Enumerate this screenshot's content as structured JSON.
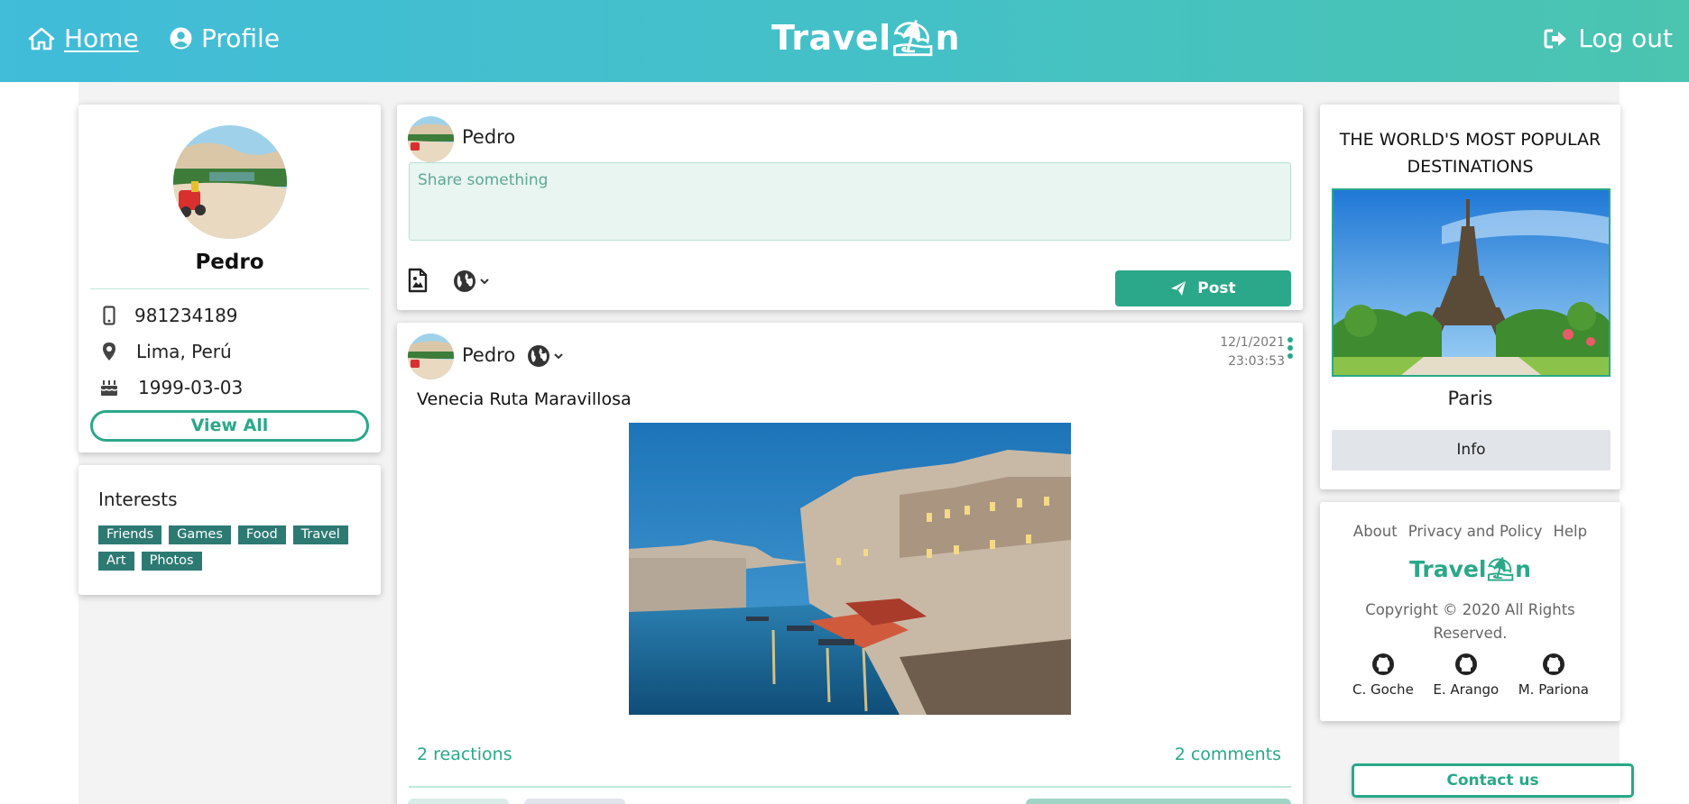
{
  "header": {
    "home_label": "Home",
    "profile_label": "Profile",
    "logo": "Travel⛱n",
    "logout_label": "Log out"
  },
  "profile": {
    "name": "Pedro",
    "phone": "981234189",
    "location": "Lima, Perú",
    "birthday": "1999-03-03",
    "view_all_label": "View All"
  },
  "interests": {
    "title": "Interests",
    "tags": [
      "Friends",
      "Games",
      "Food",
      "Travel",
      "Art",
      "Photos"
    ]
  },
  "composer": {
    "user_name": "Pedro",
    "placeholder": "Share something",
    "post_label": "Post"
  },
  "post": {
    "user_name": "Pedro",
    "date": "12/1/2021",
    "time": "23:03:53",
    "text": "Venecia Ruta Maravillosa",
    "reactions": "2 reactions",
    "comments": "2 comments"
  },
  "destinations": {
    "title": "THE WORLD'S MOST POPULAR DESTINATIONS",
    "city": "Paris",
    "info_label": "Info"
  },
  "footer": {
    "links": [
      "About",
      "Privacy and Policy",
      "Help"
    ],
    "logo": "Travel⛱n",
    "copyright": "Copyright © 2020 All Rights Reserved.",
    "authors": [
      "C. Goche",
      "E. Arango",
      "M. Pariona"
    ]
  },
  "contact_label": "Contact us",
  "colors": {
    "accent": "#2aa889",
    "tag": "#2d7a73",
    "header_start": "#41bcd9",
    "header_end": "#4bc4b0"
  }
}
